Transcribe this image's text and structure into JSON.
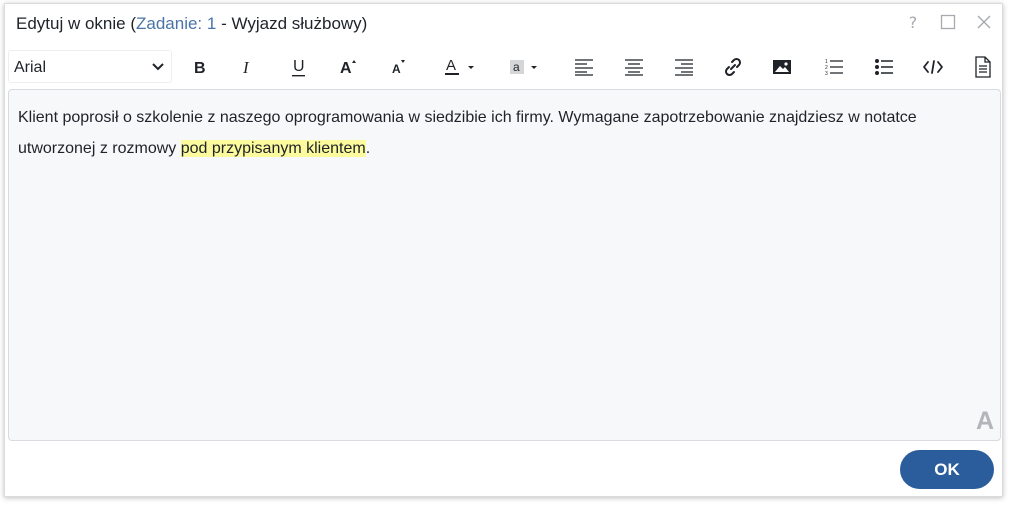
{
  "dialog": {
    "title_prefix": "Edytuj w oknie (",
    "title_link": "Zadanie: 1",
    "title_suffix": " - Wyjazd służbowy)",
    "help_label": "?",
    "ok_label": "OK"
  },
  "toolbar": {
    "font_value": "Arial",
    "font_options": [
      "Arial"
    ],
    "buttons": [
      {
        "name": "bold",
        "icon": "bold-icon",
        "glyph": "B"
      },
      {
        "name": "italic",
        "icon": "italic-icon",
        "glyph": "I"
      },
      {
        "name": "underline",
        "icon": "underline-icon",
        "glyph": "U"
      },
      {
        "name": "increase-font-size",
        "icon": "font-size-increase-icon",
        "glyph": "A"
      },
      {
        "name": "decrease-font-size",
        "icon": "font-size-decrease-icon",
        "glyph": "A"
      },
      {
        "name": "font-color",
        "icon": "font-color-icon",
        "glyph": "A"
      },
      {
        "name": "highlight-color",
        "icon": "highlight-color-icon",
        "glyph": "a"
      },
      {
        "name": "align-left",
        "icon": "align-left-icon"
      },
      {
        "name": "align-center",
        "icon": "align-center-icon"
      },
      {
        "name": "align-right",
        "icon": "align-right-icon"
      },
      {
        "name": "insert-link",
        "icon": "link-icon"
      },
      {
        "name": "insert-image",
        "icon": "image-icon"
      },
      {
        "name": "ordered-list",
        "icon": "ordered-list-icon"
      },
      {
        "name": "unordered-list",
        "icon": "unordered-list-icon"
      },
      {
        "name": "source-code",
        "icon": "code-icon"
      },
      {
        "name": "document-view",
        "icon": "document-icon"
      }
    ]
  },
  "editor": {
    "text_before": "Klient poprosił o szkolenie z naszego oprogramowania w siedzibie ich firmy. Wymagane zapotrzebowanie znajdziesz w notatce utworzonej z rozmowy ",
    "text_highlighted": "pod przypisanym klientem",
    "text_after": ".",
    "corner_mark": "A"
  },
  "colors": {
    "accent": "#2b5d9d",
    "title_link": "#4a74a8",
    "highlight": "#fbfa9c",
    "editor_background": "#f6f8fa"
  }
}
